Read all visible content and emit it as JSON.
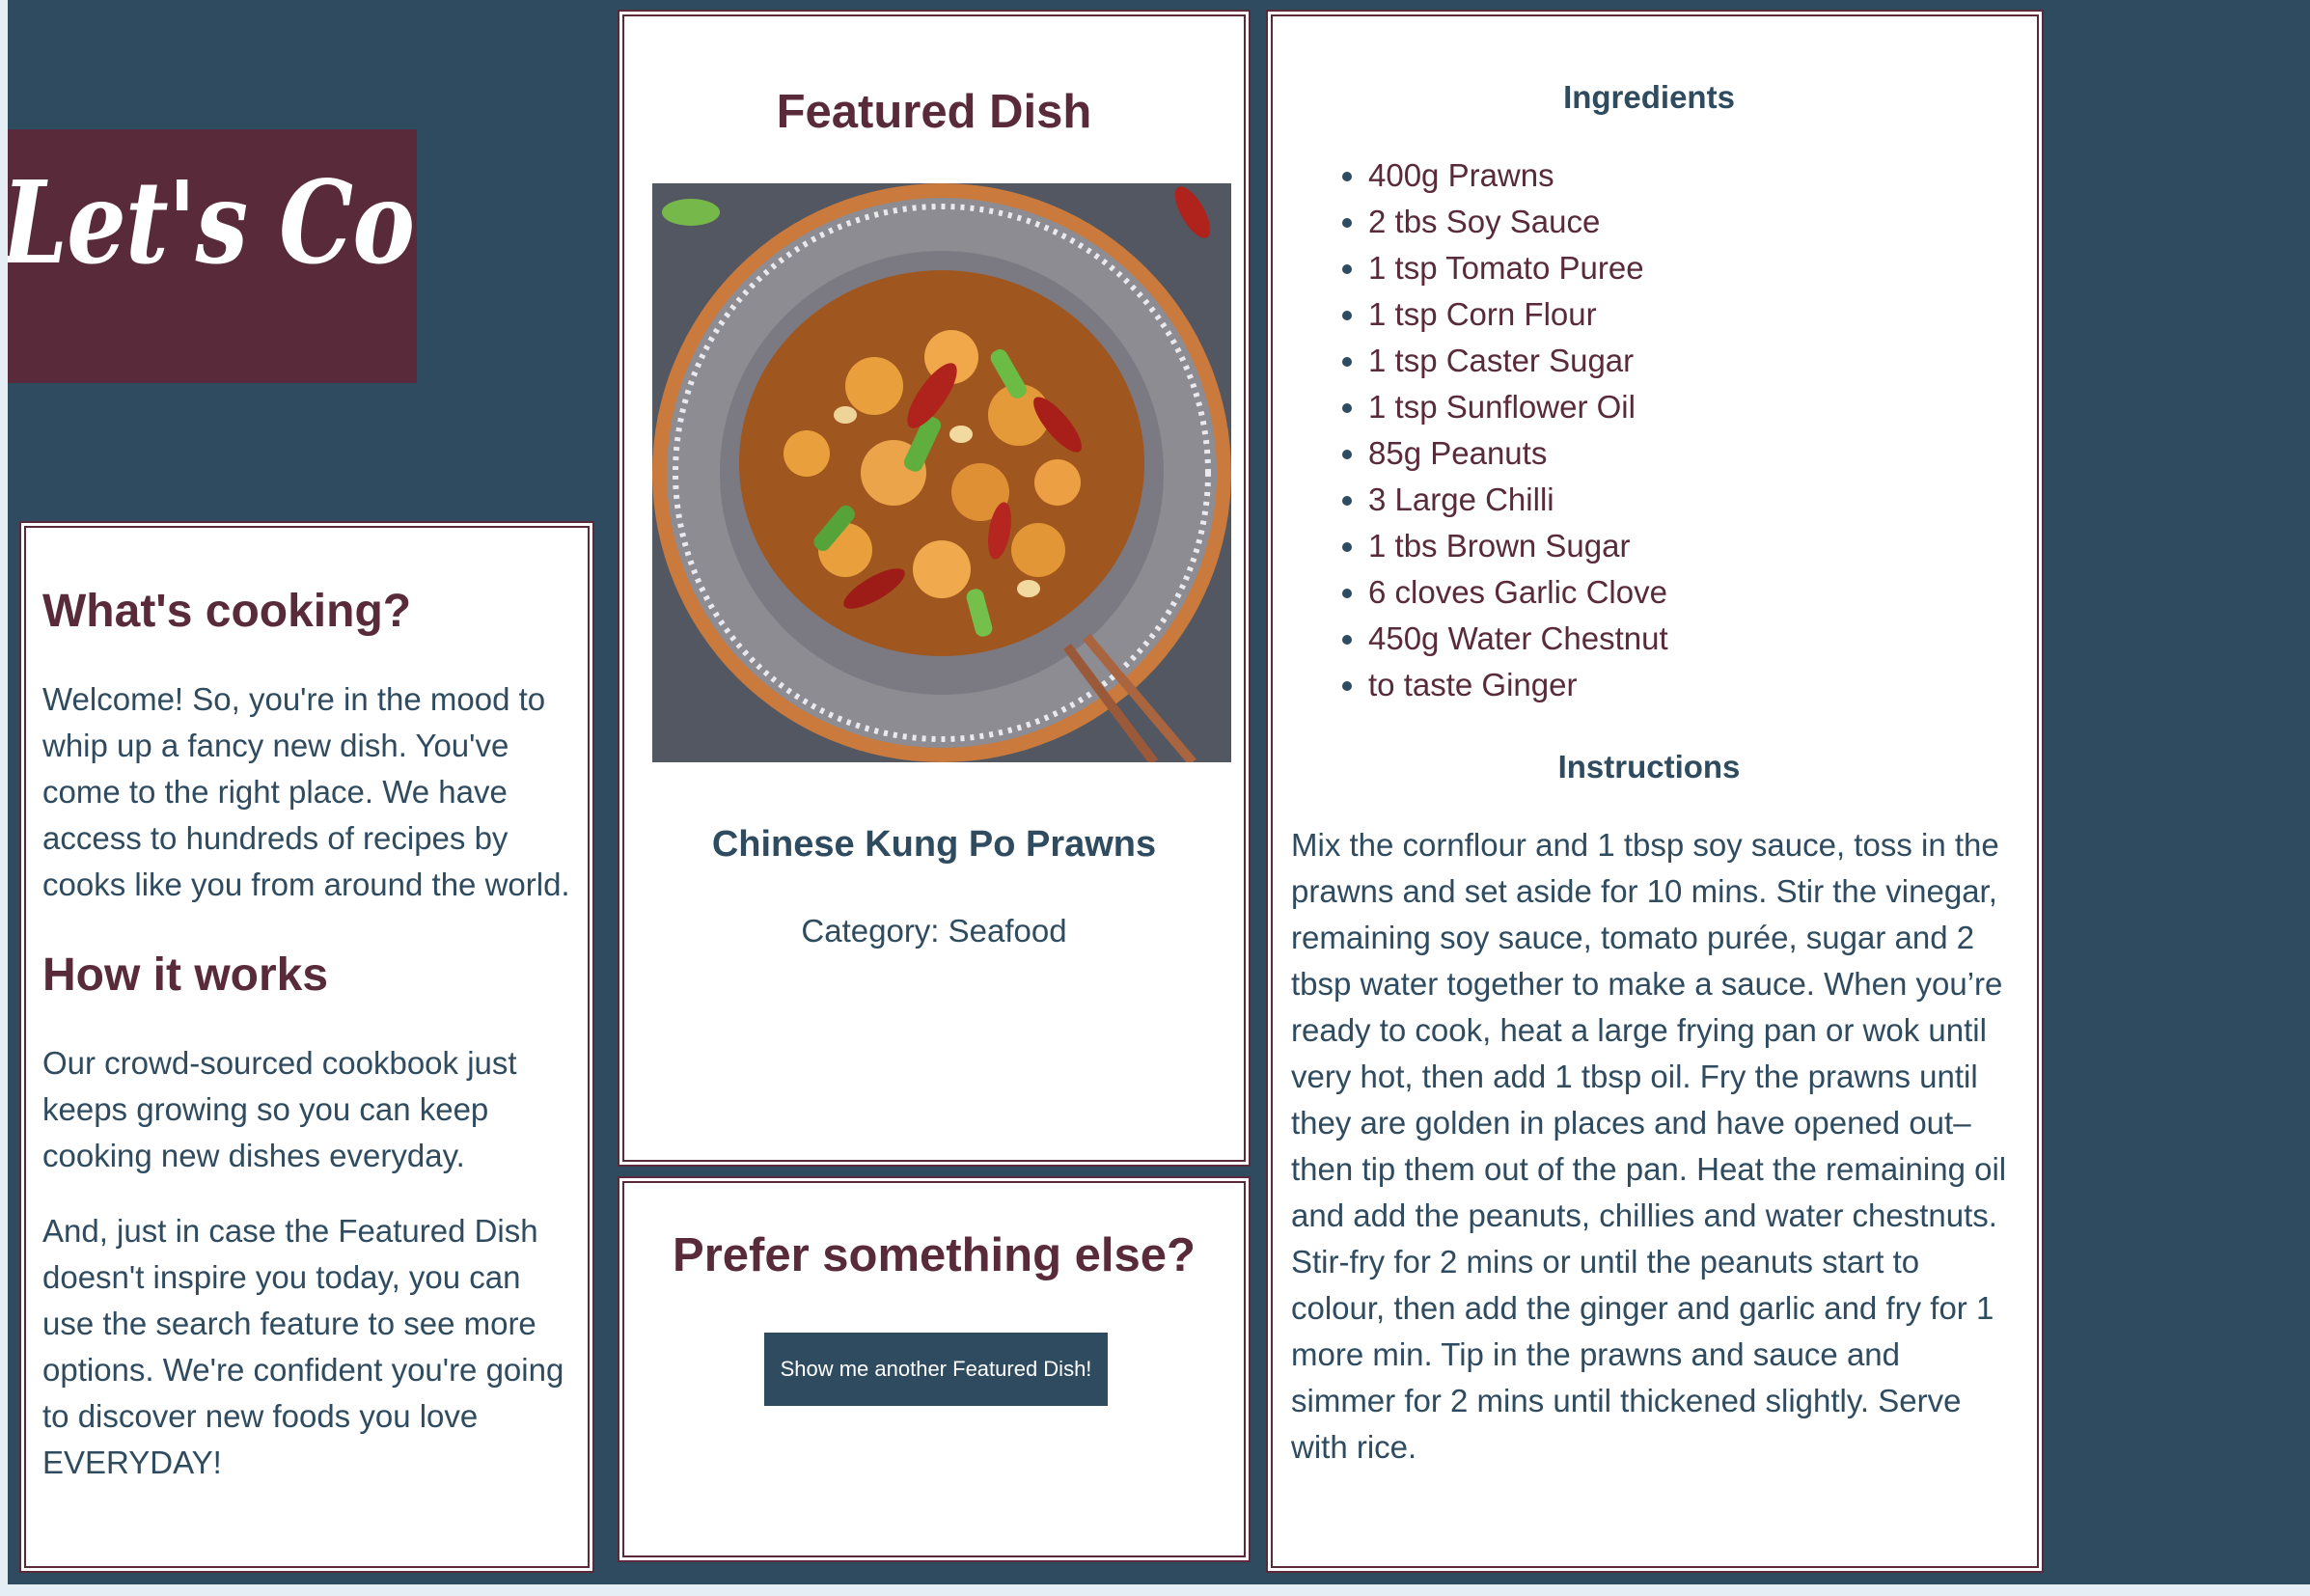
{
  "brand": {
    "logo_text": "Let's Cook!",
    "colors": {
      "background": "#2f4b5f",
      "accent": "#582a3a",
      "panel": "#ffffff"
    }
  },
  "intro": {
    "heading": "What's cooking?",
    "welcome": "Welcome! So, you're in the mood to whip up a fancy new dish. You've come to the right place. We have access to hundreds of recipes by cooks like you from around the world.",
    "how_heading": "How it works",
    "how_text": "Our crowd-sourced cookbook just keeps growing so you can keep cooking new dishes everyday.",
    "search_text": "And, just in case the Featured Dish doesn't inspire you today, you can use the search feature to see more options. We're confident you're going to discover new foods you love EVERYDAY!"
  },
  "featured": {
    "title": "Featured Dish",
    "dish_name": "Chinese Kung Po Prawns",
    "category": "Category: Seafood"
  },
  "prefer": {
    "title": "Prefer something else?",
    "button_label": "Show me another Featured Dish!"
  },
  "recipe": {
    "ingredients_heading": "Ingredients",
    "ingredients": [
      "400g Prawns",
      "2 tbs Soy Sauce",
      "1 tsp Tomato Puree",
      "1 tsp Corn Flour",
      "1 tsp Caster Sugar",
      "1 tsp Sunflower Oil",
      "85g Peanuts",
      "3 Large Chilli",
      "1 tbs Brown Sugar",
      "6 cloves Garlic Clove",
      "450g Water Chestnut",
      "to taste Ginger"
    ],
    "instructions_heading": "Instructions",
    "instructions": "Mix the cornflour and 1 tbsp soy sauce, toss in the prawns and set aside for 10 mins. Stir the vinegar, remaining soy sauce, tomato purée, sugar and 2 tbsp water together to make a sauce. When you’re ready to cook, heat a large frying pan or wok until very hot, then add 1 tbsp oil. Fry the prawns until they are golden in places and have opened out– then tip them out of the pan. Heat the remaining oil and add the peanuts, chillies and water chestnuts. Stir-fry for 2 mins or until the peanuts start to colour, then add the ginger and garlic and fry for 1 more min. Tip in the prawns and sauce and simmer for 2 mins until thickened slightly. Serve with rice."
  }
}
